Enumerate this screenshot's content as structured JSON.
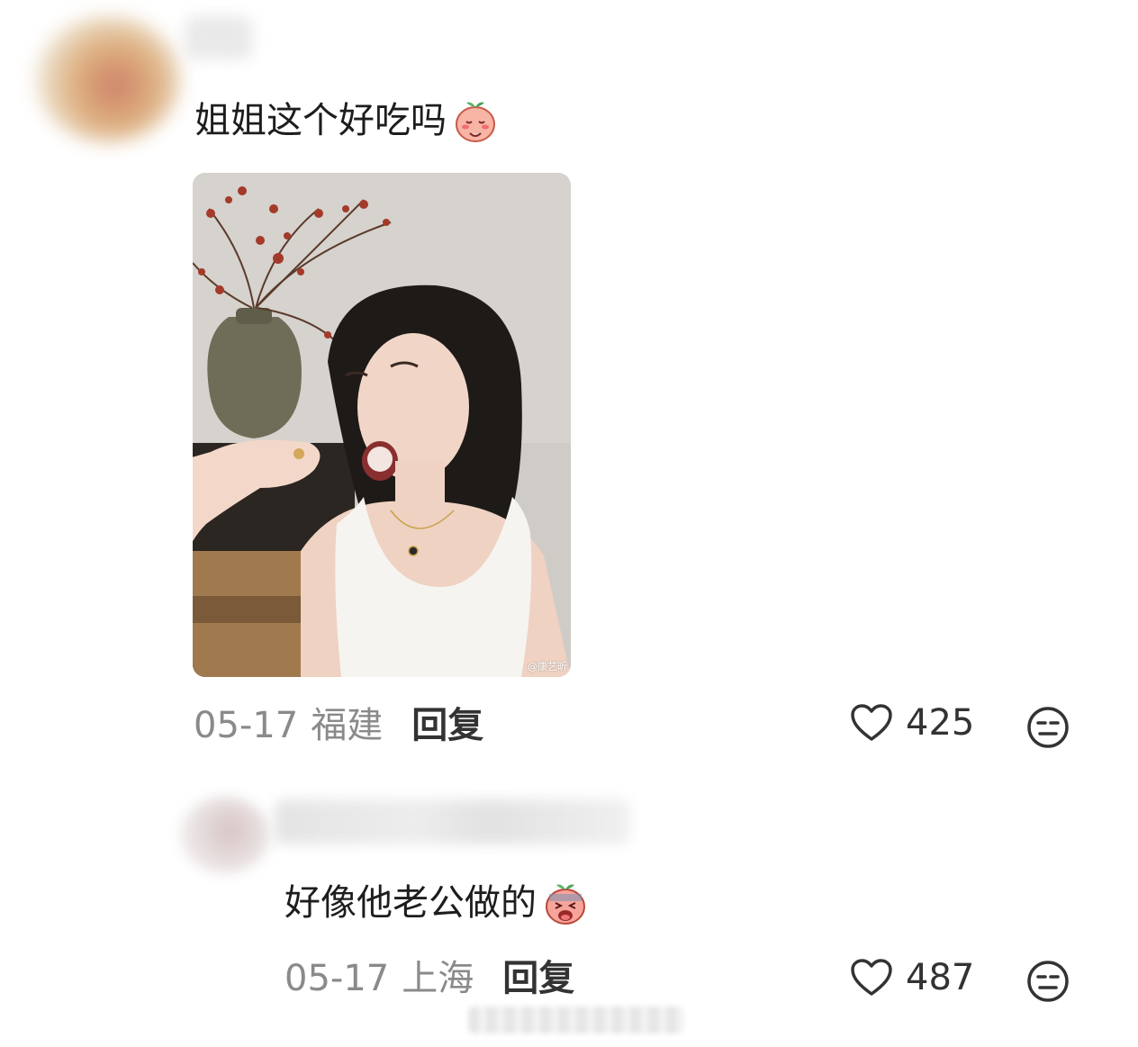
{
  "comments": [
    {
      "text": "姐姐这个好吃吗",
      "emoji": "blushing-peach-emoji",
      "image_watermark": "@康艺昕",
      "date": "05-17",
      "location": "福建",
      "reply_label": "回复",
      "likes": "425"
    },
    {
      "text": "好像他老公做的",
      "emoji": "crying-peach-emoji",
      "date": "05-17",
      "location": "上海",
      "reply_label": "回复",
      "likes": "487"
    }
  ],
  "colors": {
    "text": "#1d1d1d",
    "meta": "#8a8a8a",
    "icon": "#333333",
    "background": "#ffffff"
  },
  "icons": [
    "heart-icon",
    "neutral-face-icon"
  ]
}
